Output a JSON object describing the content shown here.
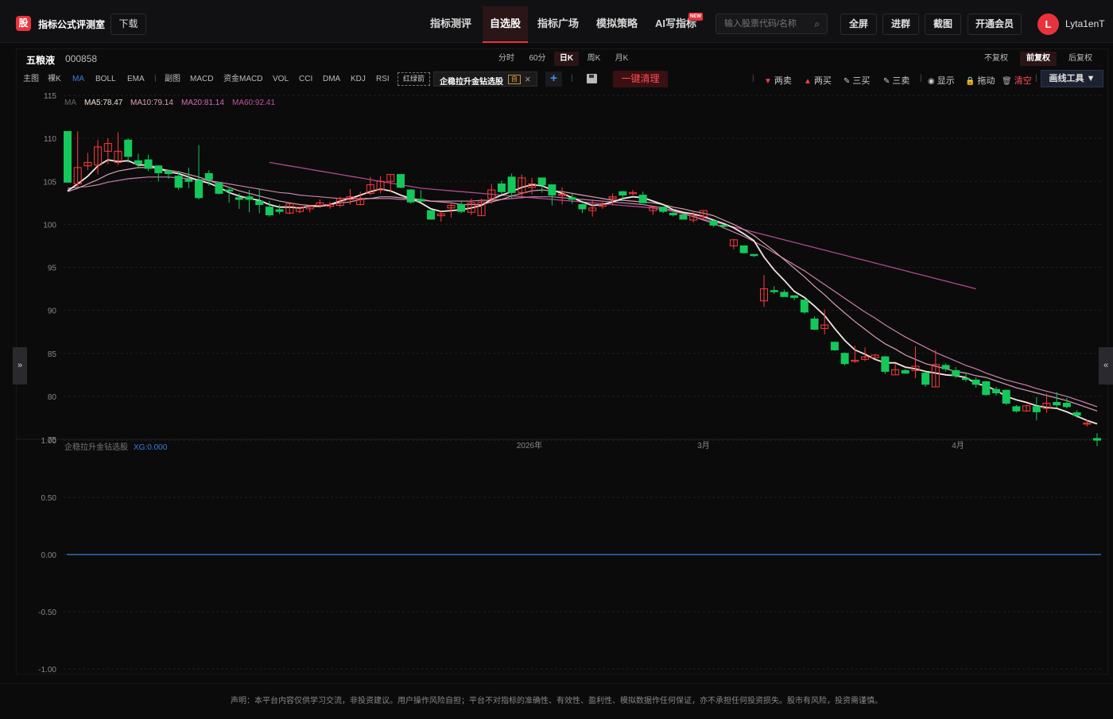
{
  "header": {
    "logo_text": "股",
    "brand": "指标公式评测室",
    "download_label": "下载",
    "nav": [
      {
        "label": "指标测评",
        "active": false
      },
      {
        "label": "自选股",
        "active": true
      },
      {
        "label": "指标广场",
        "active": false
      },
      {
        "label": "模拟策略",
        "active": false
      },
      {
        "label": "AI写指标",
        "active": false
      }
    ],
    "new_badge": "NEW",
    "search_placeholder": "输入股票代码/名称",
    "buttons": [
      "全屏",
      "进群",
      "截图",
      "开通会员"
    ],
    "avatar_letter": "L",
    "username": "Lyta1enT"
  },
  "stock": {
    "name": "五粮液",
    "code": "000858"
  },
  "periods": [
    {
      "label": "分时",
      "active": false
    },
    {
      "label": "60分",
      "active": false
    },
    {
      "label": "日K",
      "active": true
    },
    {
      "label": "周K",
      "active": false
    },
    {
      "label": "月K",
      "active": false
    }
  ],
  "adjust": [
    {
      "label": "不复权",
      "active": false
    },
    {
      "label": "前复权",
      "active": true
    },
    {
      "label": "后复权",
      "active": false
    }
  ],
  "indicators": {
    "main_group": [
      {
        "label": "主图",
        "active": false
      },
      {
        "label": "裸K",
        "active": false
      },
      {
        "label": "MA",
        "active": true
      },
      {
        "label": "BOLL",
        "active": false
      },
      {
        "label": "EMA",
        "active": false
      }
    ],
    "sub_group": [
      {
        "label": "副图"
      },
      {
        "label": "MACD"
      },
      {
        "label": "资金MACD"
      },
      {
        "label": "VOL"
      },
      {
        "label": "CCI"
      },
      {
        "label": "DMA"
      },
      {
        "label": "KDJ"
      },
      {
        "label": "RSI"
      }
    ],
    "red_green_label": "红绿箭",
    "formula_label": "企稳拉升金钻选股",
    "formula_badge": "自",
    "add_label": "+",
    "clear_label": "一键清理"
  },
  "draw_tools": [
    {
      "label": "两卖",
      "icon": "down-triangle-icon",
      "color": "#ff3b3b"
    },
    {
      "label": "两买",
      "icon": "up-triangle-icon",
      "color": "#ff3b3b"
    },
    {
      "label": "三买",
      "icon": "pen-icon",
      "color": "#cccccc"
    },
    {
      "label": "三卖",
      "icon": "pen-icon",
      "color": "#cccccc"
    },
    {
      "label": "显示",
      "icon": "eye-icon",
      "color": "#cccccc"
    },
    {
      "label": "拖动",
      "icon": "lock-icon",
      "color": "#cccccc"
    },
    {
      "label": "清空",
      "icon": "trash-icon",
      "color": "#ff4d55"
    }
  ],
  "draw_tools_button": "画线工具 ▼",
  "ma_legend": {
    "title": "MA",
    "items": [
      {
        "label": "MA5:78.47",
        "color": "#f0e0d0"
      },
      {
        "label": "MA10:79.14",
        "color": "#e0a0b0"
      },
      {
        "label": "MA20:81.14",
        "color": "#d070b0"
      },
      {
        "label": "MA60:92.41",
        "color": "#c050a0"
      }
    ]
  },
  "sub_legend": {
    "title": "企稳拉升金钻选股",
    "item": "XG:0.000"
  },
  "chart_data": {
    "type": "candlestick",
    "y_axis_main": [
      115,
      110,
      105,
      100,
      95,
      90,
      85,
      80,
      75
    ],
    "y_axis_sub": [
      "1.00",
      "0.50",
      "0.00",
      "-0.50",
      "-1.00"
    ],
    "x_labels": [
      "2026年",
      "3月",
      "4月"
    ],
    "candles": [
      [
        110.8,
        104.9,
        110.8,
        104.9
      ],
      [
        104.7,
        106.6,
        110.8,
        104.4
      ],
      [
        106.8,
        107.2,
        108.3,
        106.3
      ],
      [
        106.9,
        109.0,
        109.8,
        105.8
      ],
      [
        108.5,
        109.4,
        110.0,
        107.0
      ],
      [
        107.2,
        108.5,
        110.7,
        106.9
      ],
      [
        109.8,
        107.9,
        110.0,
        107.2
      ],
      [
        107.4,
        107.0,
        108.2,
        106.5
      ],
      [
        107.5,
        106.5,
        108.1,
        106.2
      ],
      [
        106.8,
        106.0,
        106.7,
        105.0
      ],
      [
        106.2,
        105.9,
        106.3,
        105.3
      ],
      [
        105.6,
        104.3,
        106.2,
        104.0
      ],
      [
        105.2,
        105.0,
        106.6,
        104.2
      ],
      [
        105.1,
        103.1,
        109.2,
        102.9
      ],
      [
        105.9,
        105.2,
        106.3,
        104.5
      ],
      [
        104.8,
        103.6,
        104.6,
        103.5
      ],
      [
        104.0,
        103.9,
        104.3,
        102.5
      ],
      [
        103.1,
        102.9,
        103.6,
        101.8
      ],
      [
        103.2,
        102.9,
        104.0,
        101.4
      ],
      [
        102.7,
        102.3,
        104.1,
        101.3
      ],
      [
        102.0,
        101.1,
        102.7,
        100.9
      ],
      [
        101.7,
        101.5,
        102.3,
        101.2
      ],
      [
        101.3,
        102.4,
        102.3,
        101.2
      ],
      [
        101.5,
        102.0,
        101.9,
        101.3
      ],
      [
        101.8,
        102.1,
        102.2,
        101.4
      ],
      [
        102.2,
        102.5,
        102.9,
        101.9
      ],
      [
        102.1,
        102.3,
        102.6,
        101.8
      ],
      [
        102.2,
        103.0,
        103.2,
        102.0
      ],
      [
        102.9,
        103.2,
        104.1,
        102.3
      ],
      [
        102.3,
        103.0,
        103.8,
        102.2
      ],
      [
        103.6,
        104.6,
        105.5,
        103.4
      ],
      [
        104.0,
        105.0,
        105.6,
        103.6
      ],
      [
        105.0,
        105.8,
        104.9,
        103.7
      ],
      [
        105.8,
        104.3,
        105.3,
        104.2
      ],
      [
        104.0,
        102.6,
        104.1,
        102.4
      ],
      [
        102.9,
        102.7,
        104.0,
        102.6
      ],
      [
        101.6,
        100.6,
        101.1,
        100.7
      ],
      [
        101.0,
        101.2,
        101.5,
        100.3
      ],
      [
        101.9,
        102.2,
        102.4,
        100.8
      ],
      [
        102.3,
        101.5,
        102.7,
        101.3
      ],
      [
        101.4,
        102.5,
        103.0,
        101.1
      ],
      [
        101.0,
        102.6,
        103.0,
        101.0
      ],
      [
        103.0,
        104.0,
        104.7,
        102.4
      ],
      [
        104.7,
        103.8,
        105.1,
        103.5
      ],
      [
        105.5,
        103.7,
        105.9,
        103.1
      ],
      [
        103.7,
        105.4,
        105.8,
        103.0
      ],
      [
        104.3,
        104.7,
        105.4,
        103.5
      ],
      [
        105.4,
        104.6,
        105.3,
        103.7
      ],
      [
        104.6,
        103.4,
        104.5,
        102.2
      ],
      [
        103.4,
        103.5,
        104.3,
        102.3
      ],
      [
        103.1,
        102.9,
        103.6,
        102.4
      ],
      [
        102.3,
        101.8,
        102.4,
        101.3
      ],
      [
        101.6,
        101.9,
        102.9,
        100.9
      ],
      [
        102.1,
        102.3,
        102.6,
        101.8
      ],
      [
        103.0,
        103.2,
        103.6,
        102.2
      ],
      [
        103.8,
        103.4,
        103.9,
        102.7
      ],
      [
        103.6,
        103.7,
        104.0,
        103.4
      ],
      [
        103.4,
        102.5,
        103.8,
        102.5
      ],
      [
        101.6,
        102.0,
        102.1,
        101.1
      ],
      [
        102.0,
        101.5,
        101.9,
        101.3
      ],
      [
        101.3,
        101.1,
        101.7,
        100.9
      ],
      [
        101.1,
        100.6,
        101.0,
        100.6
      ],
      [
        100.5,
        101.0,
        101.4,
        100.2
      ],
      [
        100.9,
        101.6,
        101.5,
        100.6
      ],
      [
        100.4,
        99.9,
        100.5,
        99.7
      ],
      [
        99.9,
        99.8,
        100.0,
        99.5
      ],
      [
        97.5,
        98.2,
        98.3,
        97.1
      ],
      [
        97.5,
        96.7,
        97.0,
        96.6
      ],
      [
        96.5,
        96.4,
        96.2,
        96.2
      ],
      [
        91.1,
        92.5,
        94.1,
        90.4
      ],
      [
        92.3,
        92.2,
        92.8,
        91.9
      ],
      [
        92.1,
        91.6,
        92.4,
        91.6
      ],
      [
        91.7,
        91.5,
        91.6,
        91.2
      ],
      [
        91.2,
        89.8,
        91.1,
        89.6
      ],
      [
        89.0,
        87.8,
        89.3,
        87.7
      ],
      [
        87.9,
        88.3,
        90.1,
        87.2
      ],
      [
        86.3,
        85.4,
        86.2,
        85.3
      ],
      [
        85.0,
        83.8,
        85.1,
        83.6
      ],
      [
        84.1,
        84.2,
        85.9,
        83.9
      ],
      [
        84.3,
        84.6,
        85.7,
        84.1
      ],
      [
        84.5,
        84.8,
        84.9,
        84.6
      ],
      [
        84.6,
        82.9,
        84.7,
        82.6
      ],
      [
        82.5,
        83.1,
        83.8,
        82.5
      ],
      [
        83.0,
        82.7,
        83.2,
        82.6
      ],
      [
        83.0,
        83.5,
        85.8,
        82.1
      ],
      [
        82.7,
        81.4,
        82.8,
        81.1
      ],
      [
        81.1,
        83.7,
        85.4,
        81.1
      ],
      [
        83.6,
        83.2,
        83.8,
        82.9
      ],
      [
        83.0,
        82.4,
        83.4,
        82.1
      ],
      [
        82.1,
        82.0,
        82.6,
        81.7
      ],
      [
        81.9,
        81.4,
        82.2,
        81.0
      ],
      [
        81.7,
        80.2,
        81.8,
        80.1
      ],
      [
        80.8,
        80.4,
        81.1,
        80.1
      ],
      [
        80.7,
        79.2,
        80.8,
        79.0
      ],
      [
        78.8,
        78.3,
        79.0,
        78.1
      ],
      [
        78.3,
        78.9,
        79.0,
        78.2
      ],
      [
        78.8,
        78.2,
        79.9,
        77.2
      ],
      [
        78.6,
        79.2,
        80.3,
        78.1
      ],
      [
        79.3,
        79.0,
        80.5,
        78.7
      ],
      [
        79.2,
        78.8,
        79.8,
        78.6
      ],
      [
        78.1,
        77.8,
        78.4,
        77.5
      ],
      [
        76.9,
        76.9,
        77.3,
        76.5
      ],
      [
        75.1,
        74.9,
        75.7,
        74.2
      ]
    ],
    "ma5": [
      103.9,
      104.7,
      105.6,
      106.8,
      107.5,
      107.3,
      107.4,
      106.9,
      106.9,
      106.5,
      106.1,
      105.9,
      105.5,
      105.1,
      104.8,
      104.3,
      103.7,
      103.3,
      103.0,
      102.8,
      102.3,
      102.0,
      102.0,
      101.9,
      102.1,
      102.1,
      102.3,
      102.7,
      103.0,
      103.4,
      103.8,
      104.1,
      103.9,
      103.4,
      103.0,
      102.5,
      101.8,
      101.5,
      101.6,
      101.7,
      101.9,
      102.2,
      102.9,
      103.4,
      103.8,
      104.3,
      104.6,
      104.5,
      104.0,
      103.6,
      103.1,
      102.6,
      102.2,
      102.3,
      102.6,
      103.0,
      103.2,
      103.1,
      102.7,
      102.3,
      101.7,
      101.4,
      101.2,
      100.9,
      100.5,
      100.1,
      99.6,
      98.9,
      98.1,
      96.2,
      94.7,
      93.5,
      92.2,
      91.5,
      90.5,
      89.4,
      87.9,
      86.5,
      85.4,
      84.9,
      84.3,
      83.9,
      83.9,
      83.4,
      83.2,
      82.9,
      82.7,
      82.5,
      82.4,
      82.2,
      81.5,
      81.2,
      80.7,
      80.0,
      79.6,
      79.3,
      78.9,
      78.7,
      78.6,
      78.2,
      77.7,
      77.2,
      76.8
    ],
    "ma10": [
      103.8,
      104.2,
      104.7,
      105.2,
      105.8,
      106.2,
      106.4,
      106.6,
      106.6,
      106.5,
      106.3,
      106.1,
      105.8,
      105.5,
      105.1,
      104.7,
      104.3,
      103.9,
      103.6,
      103.3,
      103.0,
      102.7,
      102.5,
      102.3,
      102.2,
      102.2,
      102.3,
      102.5,
      102.6,
      102.9,
      103.0,
      103.2,
      103.2,
      103.1,
      103.0,
      102.9,
      102.7,
      102.6,
      102.5,
      102.3,
      102.3,
      102.3,
      102.6,
      102.9,
      103.3,
      103.6,
      103.9,
      104.0,
      103.9,
      103.8,
      103.6,
      103.4,
      103.2,
      103.0,
      102.8,
      102.8,
      102.7,
      102.6,
      102.5,
      102.3,
      102.0,
      101.8,
      101.5,
      101.3,
      101.0,
      100.5,
      100.0,
      99.4,
      98.7,
      97.8,
      96.9,
      95.9,
      94.9,
      93.9,
      92.8,
      91.8,
      90.7,
      89.7,
      88.7,
      87.8,
      86.9,
      86.1,
      85.5,
      84.8,
      84.3,
      83.8,
      83.5,
      83.2,
      82.9,
      82.7,
      82.4,
      82.2,
      81.8,
      81.4,
      81.0,
      80.7,
      80.4,
      80.1,
      79.8,
      79.5,
      79.1,
      78.7,
      78.3
    ],
    "ma20": [
      104.2,
      104.3,
      104.4,
      104.6,
      104.9,
      105.1,
      105.3,
      105.4,
      105.5,
      105.5,
      105.5,
      105.4,
      105.3,
      105.2,
      105.1,
      104.9,
      104.7,
      104.5,
      104.3,
      104.1,
      103.9,
      103.7,
      103.6,
      103.4,
      103.3,
      103.2,
      103.1,
      103.0,
      103.0,
      103.0,
      103.0,
      103.0,
      103.0,
      102.9,
      102.9,
      102.8,
      102.7,
      102.7,
      102.7,
      102.7,
      102.7,
      102.8,
      102.8,
      102.9,
      103.0,
      103.1,
      103.2,
      103.2,
      103.2,
      103.1,
      103.0,
      102.9,
      102.8,
      102.7,
      102.6,
      102.5,
      102.4,
      102.3,
      102.1,
      101.9,
      101.6,
      101.3,
      100.9,
      100.5,
      100.1,
      99.6,
      99.1,
      98.6,
      98.0,
      97.4,
      96.7,
      96.0,
      95.3,
      94.6,
      93.8,
      93.0,
      92.2,
      91.4,
      90.6,
      89.8,
      89.1,
      88.3,
      87.6,
      86.9,
      86.3,
      85.7,
      85.1,
      84.6,
      84.1,
      83.6,
      83.2,
      82.7,
      82.3,
      81.9,
      81.6,
      81.3,
      80.9,
      80.6,
      80.3,
      80.0,
      79.6,
      79.2,
      78.8
    ],
    "ma60": [
      null,
      null,
      null,
      null,
      null,
      null,
      null,
      null,
      null,
      null,
      null,
      null,
      null,
      null,
      null,
      null,
      null,
      null,
      null,
      null,
      107.2,
      107.0,
      106.8,
      106.6,
      106.4,
      106.2,
      106.0,
      105.8,
      105.6,
      105.4,
      105.2,
      105.0,
      104.8,
      104.6,
      104.4,
      104.2,
      104.1,
      104.0,
      103.9,
      103.8,
      103.7,
      103.6,
      103.5,
      103.4,
      103.3,
      103.2,
      103.1,
      103.0,
      102.9,
      102.8,
      102.7,
      102.6,
      102.5,
      102.4,
      102.3,
      102.2,
      102.1,
      102.0,
      101.9,
      101.7,
      101.5,
      101.2,
      100.9,
      100.6,
      100.3,
      100.0,
      99.7,
      99.4,
      99.1,
      98.8,
      98.5,
      98.2,
      97.9,
      97.6,
      97.3,
      97.0,
      96.7,
      96.4,
      96.1,
      95.8,
      95.5,
      95.2,
      94.9,
      94.6,
      94.3,
      94.0,
      93.7,
      93.4,
      93.1,
      92.8,
      92.5
    ],
    "xg_value": 0.0
  }
}
